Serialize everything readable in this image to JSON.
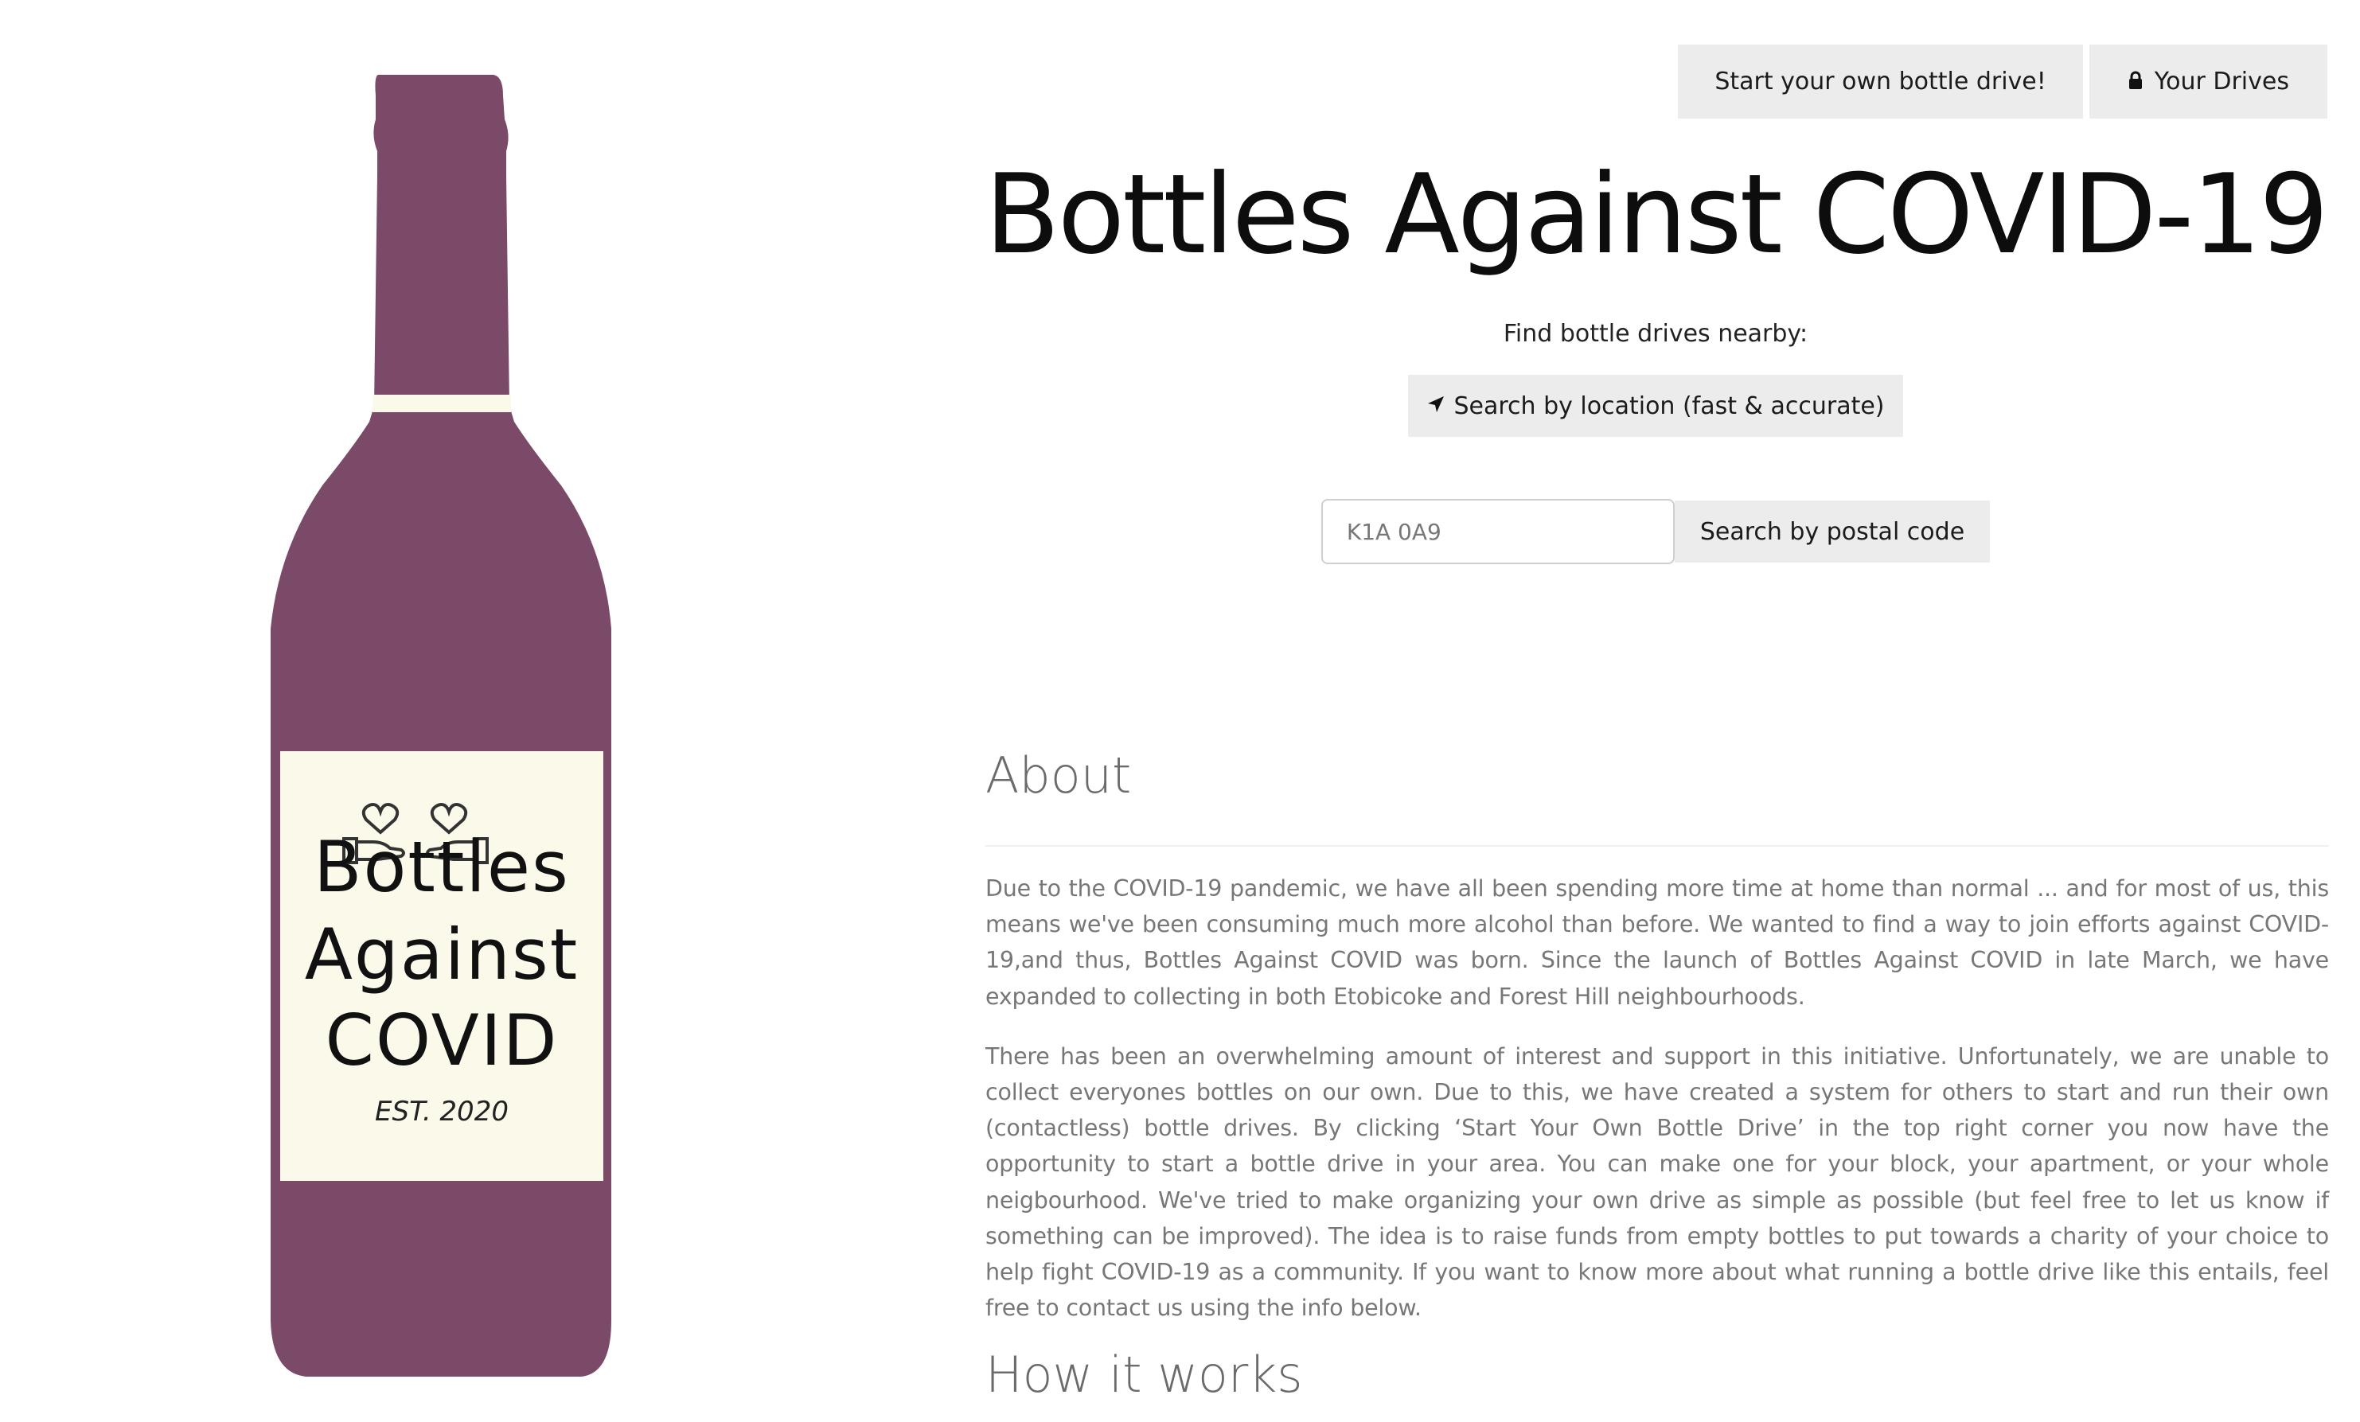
{
  "nav": {
    "start_drive_label": "Start your own bottle drive!",
    "your_drives_label": "Your Drives",
    "your_drives_icon": "lock-icon"
  },
  "hero": {
    "title": "Bottles Against COVID-19",
    "find_label": "Find bottle drives nearby:",
    "location_button_label": "Search by location (fast & accurate)",
    "location_button_icon": "location-arrow-icon",
    "postal_placeholder": "K1A 0A9",
    "postal_button_label": "Search by postal code"
  },
  "logo": {
    "line1": "Bottles",
    "line2": "Against",
    "line3": "COVID",
    "est": "EST. 2020",
    "bottle_color": "#7b4a68",
    "label_color": "#fbfaea"
  },
  "about": {
    "heading": "About",
    "paragraph1": "Due to the COVID-19 pandemic, we have all been spending more time at home than normal ... and for most of us, this means we've been consuming much more alcohol than before. We wanted to find a way to join efforts against COVID-19,and thus, Bottles Against COVID was born. Since the launch of Bottles Against COVID in late March, we have expanded to collecting in both Etobicoke and Forest Hill neighbourhoods.",
    "paragraph2": "There has been an overwhelming amount of interest and support in this initiative. Unfortunately, we are unable to collect everyones bottles on our own. Due to this, we have created a system for others to start and run their own (contactless) bottle drives. By clicking ‘Start Your Own Bottle Drive’ in the top right corner you now have the opportunity to start a bottle drive in your area. You can make one for your block, your apartment, or your whole neigbourhood. We've tried to make organizing your own drive as simple as possible (but feel free to let us know if something can be improved). The idea is to raise funds from empty bottles to put towards a charity of your choice to help fight COVID-19 as a community. If you want to know more about what running a bottle drive like this entails, feel free to contact us using the info below.",
    "how_heading": "How it works"
  }
}
